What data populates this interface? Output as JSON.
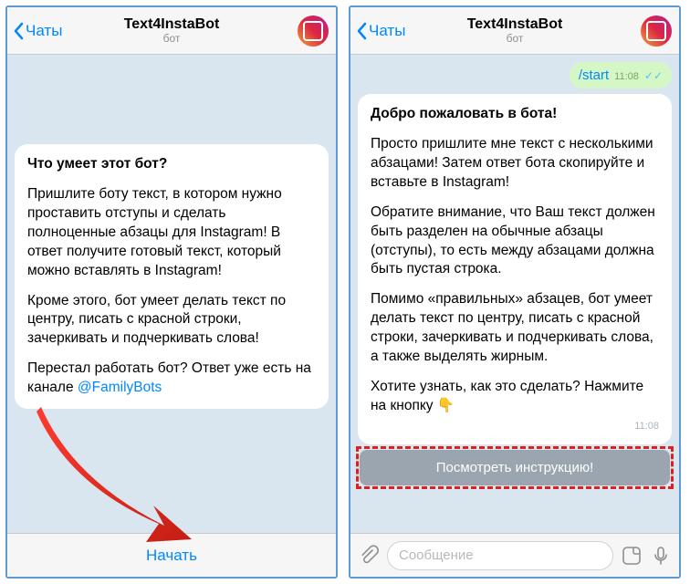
{
  "header": {
    "back_label": "Чаты",
    "title": "Text4InstaBot",
    "subtitle": "бот"
  },
  "left": {
    "heading": "Что умеет этот бот?",
    "p1": "Пришлите боту текст, в котором нужно проставить отступы и сделать полноценные абзацы для Instagram! В ответ получите готовый текст, который можно вставлять в Instagram!",
    "p2": "Кроме этого, бот умеет делать текст по центру, писать с красной строки, зачеркивать и подчеркивать слова!",
    "p3_a": "Перестал работать бот? Ответ уже есть на канале ",
    "p3_link": "@FamilyBots",
    "start_btn": "Начать"
  },
  "right": {
    "out_cmd": "/start",
    "out_time": "11:08",
    "heading": "Добро пожаловать в бота!",
    "p1": "Просто пришлите мне текст с несколькими абзацами! Затем ответ бота скопируйте и вставьте в Instagram!",
    "p2": "Обратите внимание, что Ваш текст должен быть разделен на обычные абзацы (отступы), то есть между абзацами должна быть пустая строка.",
    "p3": "Помимо «правильных» абзацев, бот умеет делать текст по центру, писать с красной строки, зачеркивать и подчеркивать слова, а также выделять жирным.",
    "p4": "Хотите узнать, как это сделать? Нажмите на кнопку 👇",
    "msg_time": "11:08",
    "inline_btn": "Посмотреть инструкцию!",
    "placeholder": "Сообщение"
  }
}
